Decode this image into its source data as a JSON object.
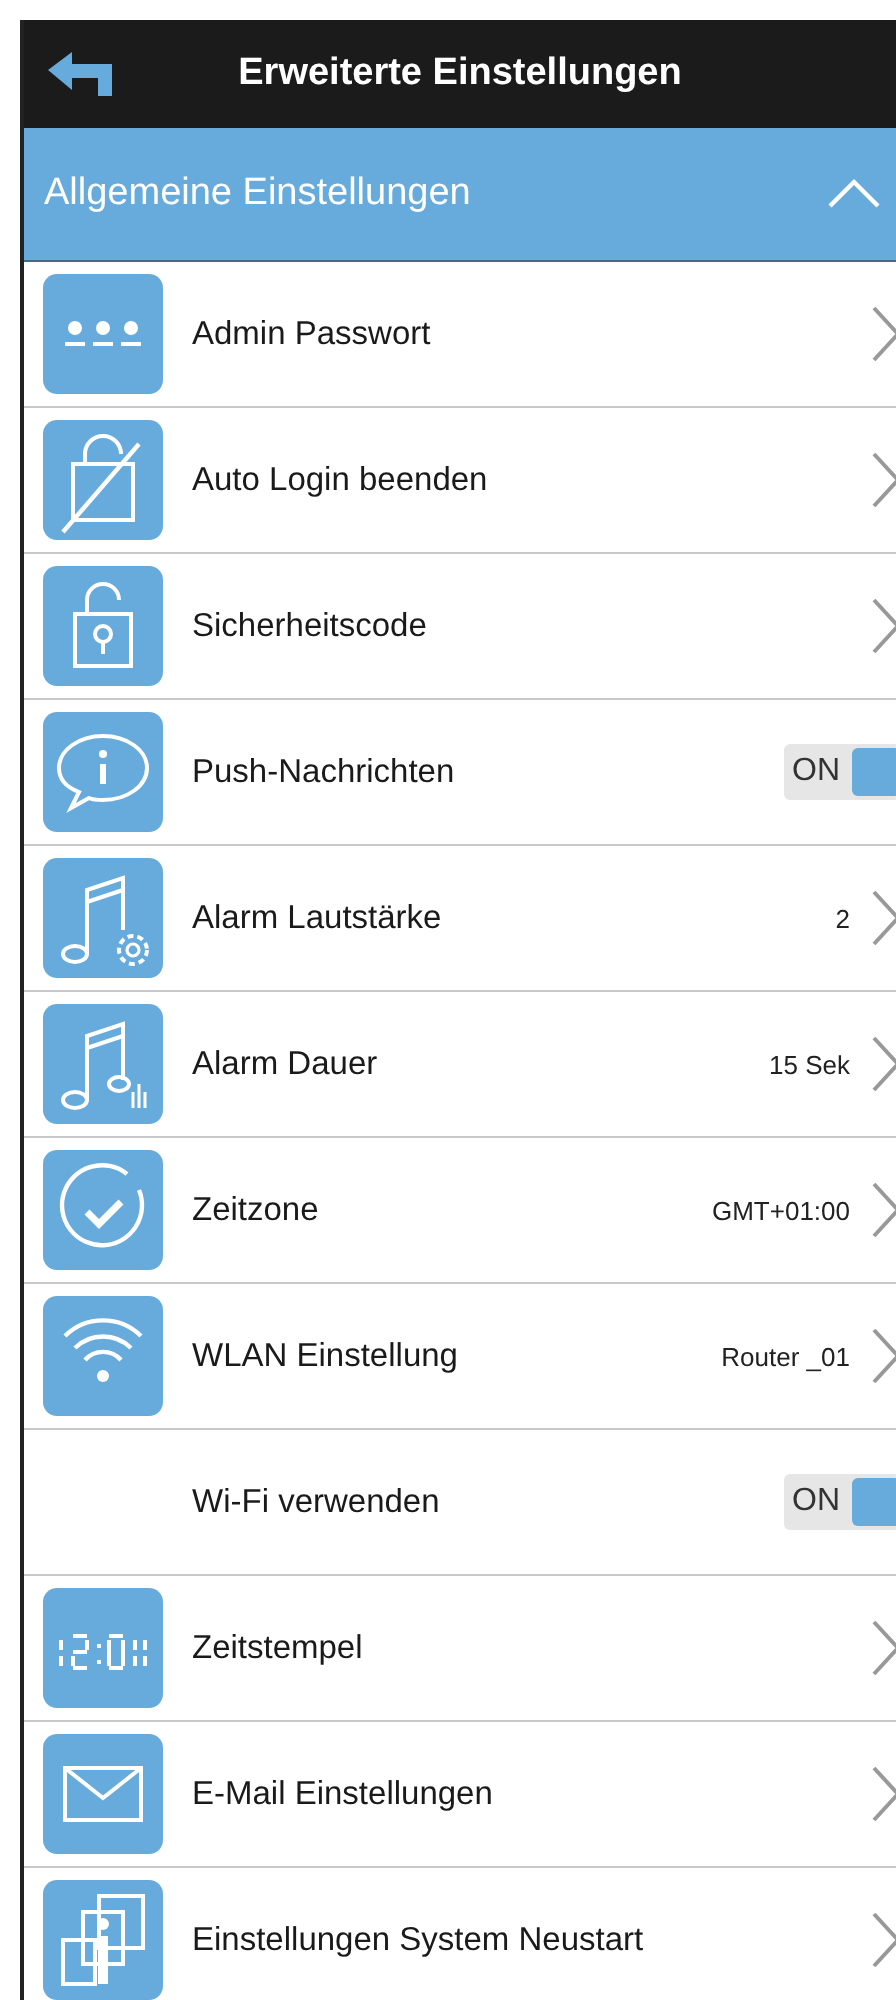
{
  "header": {
    "title": "Erweiterte Einstellungen"
  },
  "section": {
    "title": "Allgemeine Einstellungen",
    "expanded": true
  },
  "rows": [
    {
      "kind": "link",
      "label": "Admin Passwort"
    },
    {
      "kind": "link",
      "label": "Auto Login beenden"
    },
    {
      "kind": "link",
      "label": "Sicherheitscode"
    },
    {
      "kind": "toggle",
      "label": "Push-Nachrichten",
      "on": true,
      "state_label": "ON"
    },
    {
      "kind": "link",
      "label": "Alarm Lautstärke",
      "value": "2"
    },
    {
      "kind": "link",
      "label": "Alarm Dauer",
      "value": "15 Sek"
    },
    {
      "kind": "link",
      "label": "Zeitzone",
      "value": "GMT+01:00"
    },
    {
      "kind": "link",
      "label": "WLAN Einstellung",
      "value": "Router _01"
    },
    {
      "kind": "toggle",
      "label": "Wi-Fi verwenden",
      "on": true,
      "state_label": "ON"
    },
    {
      "kind": "link",
      "label": "Zeitstempel"
    },
    {
      "kind": "link",
      "label": "E-Mail Einstellungen"
    },
    {
      "kind": "link",
      "label": "Einstellungen System Neustart"
    }
  ]
}
